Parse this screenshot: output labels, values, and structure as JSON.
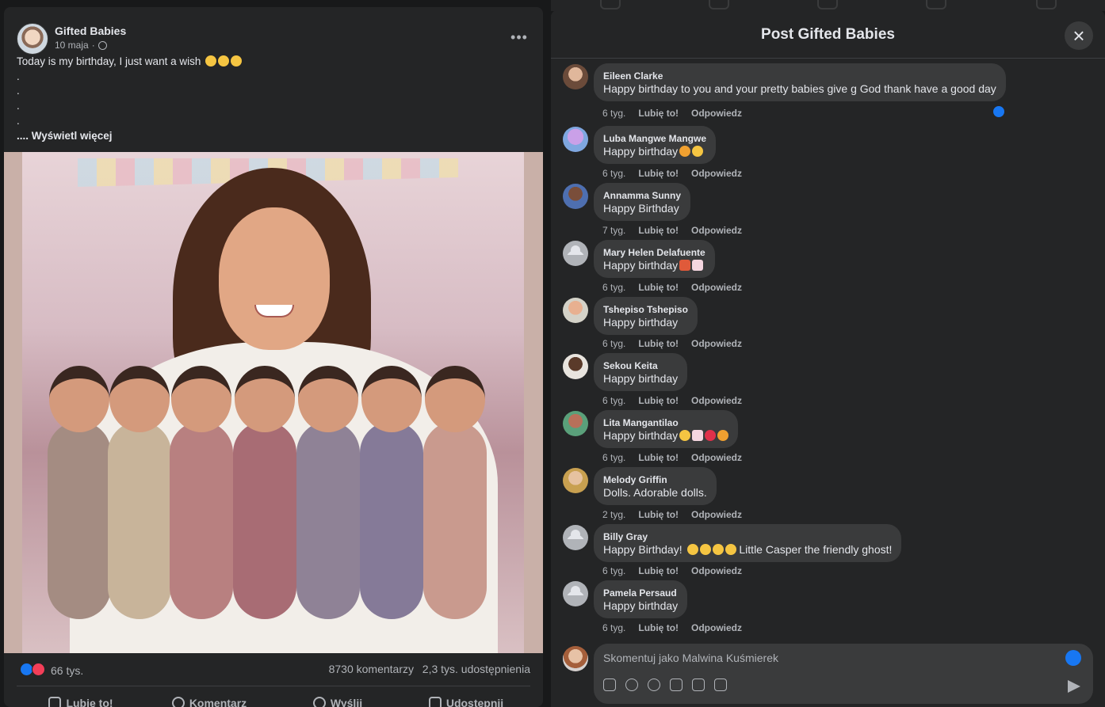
{
  "post": {
    "page_name": "Gifted Babies",
    "date": "10 maja",
    "text_line1": "Today is my birthday, I just want a wish",
    "dots": [
      ".",
      ".",
      ".",
      "."
    ],
    "see_more": ".... Wyświetl więcej",
    "reaction_count": "66 tys.",
    "comment_count": "8730 komentarzy",
    "share_count": "2,3 tys. udostępnienia",
    "actions": {
      "like": "Lubię to!",
      "comment": "Komentarz",
      "send": "Wyślij",
      "share": "Udostępnij"
    }
  },
  "dialog": {
    "title": "Post Gifted Babies",
    "comments": [
      {
        "name": "Eileen Clarke",
        "text": "Happy birthday to you and your pretty babies give g God thank have a good day",
        "time": "6 tyg."
      },
      {
        "name": "Luba Mangwe Mangwe",
        "text": "Happy birthday",
        "time": "6 tyg."
      },
      {
        "name": "Annamma Sunny",
        "text": "Happy Birthday",
        "time": "7 tyg."
      },
      {
        "name": "Mary Helen Delafuente",
        "text": "Happy birthday",
        "time": "6 tyg."
      },
      {
        "name": "Tshepiso Tshepiso",
        "text": "Happy birthday",
        "time": "6 tyg."
      },
      {
        "name": "Sekou Keita",
        "text": "Happy birthday",
        "time": "6 tyg."
      },
      {
        "name": "Lita Mangantilao",
        "text": "Happy birthday",
        "time": "6 tyg."
      },
      {
        "name": "Melody Griffin",
        "text": "Dolls. Adorable dolls.",
        "time": "2 tyg."
      },
      {
        "name": "Billy Gray",
        "text": "Happy Birthday!",
        "text_after": "Little Casper the friendly ghost!",
        "time": "6 tyg."
      },
      {
        "name": "Pamela Persaud",
        "text": "Happy birthday",
        "time": "6 tyg."
      }
    ],
    "like_label": "Lubię to!",
    "reply_label": "Odpowiedz",
    "composer_placeholder": "Skomentuj jako Malwina Kuśmierek"
  },
  "colors": {
    "background": "#18191a",
    "card": "#242526",
    "bubble": "#3a3b3c",
    "accent": "#1877f2",
    "love": "#f33e58"
  }
}
